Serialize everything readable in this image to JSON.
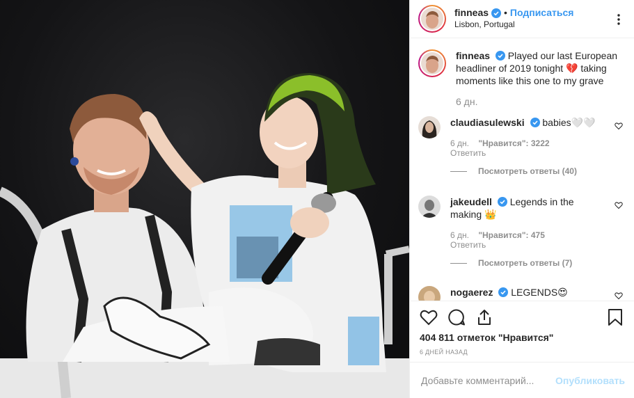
{
  "header": {
    "username": "finneas",
    "dot": "•",
    "follow_label": "Подписаться",
    "location": "Lisbon, Portugal"
  },
  "caption": {
    "username": "finneas",
    "text": "Played our last European headliner of 2019 tonight 💔 taking moments like this one to my grave",
    "time": "6 дн."
  },
  "comments": [
    {
      "username": "claudiasulewski",
      "text": "babies🤍🤍",
      "time": "6 дн.",
      "likes": "\"Нравится\": 3222",
      "reply": "Ответить",
      "view_replies": "Посмотреть ответы (40)"
    },
    {
      "username": "jakeudell",
      "text": "Legends in the making 👑",
      "time": "6 дн.",
      "likes": "\"Нравится\": 475",
      "reply": "Ответить",
      "view_replies": "Посмотреть ответы (7)"
    },
    {
      "username": "nogaerez",
      "text": "LEGENDS😍"
    }
  ],
  "actions": {
    "likes_text": "404 811 отметок \"Нравится\"",
    "time_ago": "6 ДНЕЙ НАЗАД"
  },
  "add_comment": {
    "placeholder": "Добавьте комментарий...",
    "publish_label": "Опубликовать"
  },
  "colors": {
    "link": "#3897f0",
    "verified": "#3897f0",
    "muted": "#8e8e8e",
    "publish_disabled": "#b2dffc"
  },
  "icons": [
    "verified-badge-icon",
    "more-options-icon",
    "heart-icon",
    "comment-icon",
    "share-icon",
    "bookmark-icon"
  ]
}
